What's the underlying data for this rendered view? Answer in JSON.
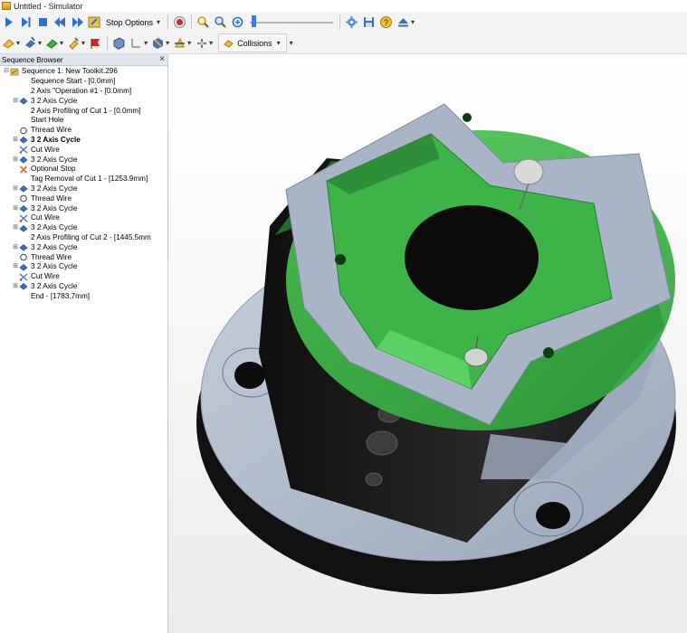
{
  "window": {
    "title": "Untitled - Simulator"
  },
  "toolbar": {
    "stop_options_label": "Stop Options",
    "collisions_label": "Collisions",
    "playback_position": 0.02
  },
  "panel": {
    "title": "Sequence Browser",
    "close_glyph": "×"
  },
  "sequence": {
    "root_label": "Sequence 1: New Toolkit.296",
    "items": [
      {
        "label": "Sequence Start - [0.0mm]",
        "icon": "none",
        "bold": false,
        "expander": ""
      },
      {
        "label": "2 Axis \"Operation #1 - [0.0mm]",
        "icon": "none",
        "bold": false,
        "expander": ""
      },
      {
        "label": "3 2 Axis Cycle",
        "icon": "cycle-icon",
        "bold": false,
        "expander": "⊞"
      },
      {
        "label": "2 Axis Profiling of Cut 1 - [0.0mm]",
        "icon": "none",
        "bold": false,
        "expander": ""
      },
      {
        "label": "Start Hole",
        "icon": "none",
        "bold": false,
        "expander": ""
      },
      {
        "label": "Thread Wire",
        "icon": "thread-icon",
        "bold": false,
        "expander": ""
      },
      {
        "label": "3 2 Axis Cycle",
        "icon": "cycle-icon",
        "bold": true,
        "expander": "⊞"
      },
      {
        "label": "Cut Wire",
        "icon": "cut-icon",
        "bold": false,
        "expander": ""
      },
      {
        "label": "3 2 Axis Cycle",
        "icon": "cycle-icon",
        "bold": false,
        "expander": "⊞"
      },
      {
        "label": "Optional Stop",
        "icon": "stop-icon",
        "bold": false,
        "expander": ""
      },
      {
        "label": "Tag Removal of Cut 1 - [1253.9mm]",
        "icon": "none",
        "bold": false,
        "expander": ""
      },
      {
        "label": "3 2 Axis Cycle",
        "icon": "cycle-icon",
        "bold": false,
        "expander": "⊞"
      },
      {
        "label": "Thread Wire",
        "icon": "thread-icon",
        "bold": false,
        "expander": ""
      },
      {
        "label": "3 2 Axis Cycle",
        "icon": "cycle-icon",
        "bold": false,
        "expander": "⊞"
      },
      {
        "label": "Cut Wire",
        "icon": "cut-icon",
        "bold": false,
        "expander": ""
      },
      {
        "label": "3 2 Axis Cycle",
        "icon": "cycle-icon",
        "bold": false,
        "expander": "⊞"
      },
      {
        "label": "2 Axis Profiling of Cut 2 - [1445.5mm",
        "icon": "none",
        "bold": false,
        "expander": ""
      },
      {
        "label": "3 2 Axis Cycle",
        "icon": "cycle-icon",
        "bold": false,
        "expander": "⊞"
      },
      {
        "label": "Thread Wire",
        "icon": "thread-icon",
        "bold": false,
        "expander": ""
      },
      {
        "label": "3 2 Axis Cycle",
        "icon": "cycle-icon",
        "bold": false,
        "expander": "⊞"
      },
      {
        "label": "Cut Wire",
        "icon": "cut-icon",
        "bold": false,
        "expander": ""
      },
      {
        "label": "3 2 Axis Cycle",
        "icon": "cycle-icon",
        "bold": false,
        "expander": "⊞"
      },
      {
        "label": "End - [1783.7mm]",
        "icon": "none",
        "bold": false,
        "expander": ""
      }
    ]
  },
  "colors": {
    "play_blue": "#2f6fd0",
    "record_red": "#d42828",
    "part_green": "#3fb84a",
    "part_gray": "#a8b4c6",
    "part_dark": "#1c1c1c"
  }
}
